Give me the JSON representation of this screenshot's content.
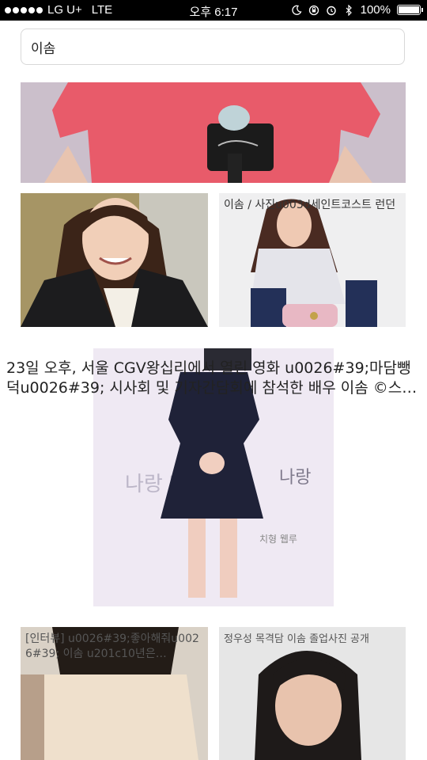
{
  "status_bar": {
    "carrier": "LG U+",
    "network": "LTE",
    "time": "오후 6:17",
    "battery": "100%"
  },
  "search": {
    "value": "이솜"
  },
  "results": [
    {
      "caption": ""
    },
    {
      "caption": ""
    },
    {
      "caption": "이솜 / 사진u003d세인트코스트 런던"
    },
    {
      "caption": "23일 오후, 서울 CGV왕십리에서 열린 영화 u0026#39;마담뺑덕u0026#39; 시사회 및 기자간담회에 참석한 배우 이솜 ©스…"
    },
    {
      "caption": "[인터뷰] u0026#39;좋아해줘u0026#39; 이솜 u201c10년은…"
    },
    {
      "caption": "정우성 목격담 이솜 졸업사진 공개"
    }
  ],
  "colors": {
    "status_bg": "#000000",
    "search_border": "#d8d8d8"
  }
}
